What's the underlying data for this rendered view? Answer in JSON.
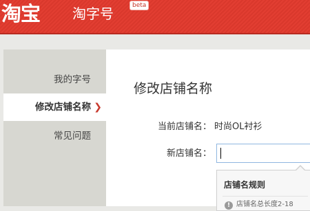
{
  "header": {
    "logo": "淘宝",
    "product": "淘字号",
    "badge": "beta"
  },
  "sidebar": {
    "items": [
      {
        "label": "我的字号",
        "active": false
      },
      {
        "label": "修改店铺名称",
        "active": true
      },
      {
        "label": "常见问题",
        "active": false
      }
    ],
    "active_marker": "❯"
  },
  "main": {
    "title": "修改店铺名称",
    "current_label": "当前店铺名：",
    "current_value": "时尚OL衬衫",
    "new_label": "新店铺名：",
    "new_value": ""
  },
  "rules": {
    "title": "店铺名规则",
    "text": "店铺名总长度2-18"
  },
  "colors": {
    "brand_red": "#e23a2e",
    "input_border": "#8fb6e0"
  }
}
